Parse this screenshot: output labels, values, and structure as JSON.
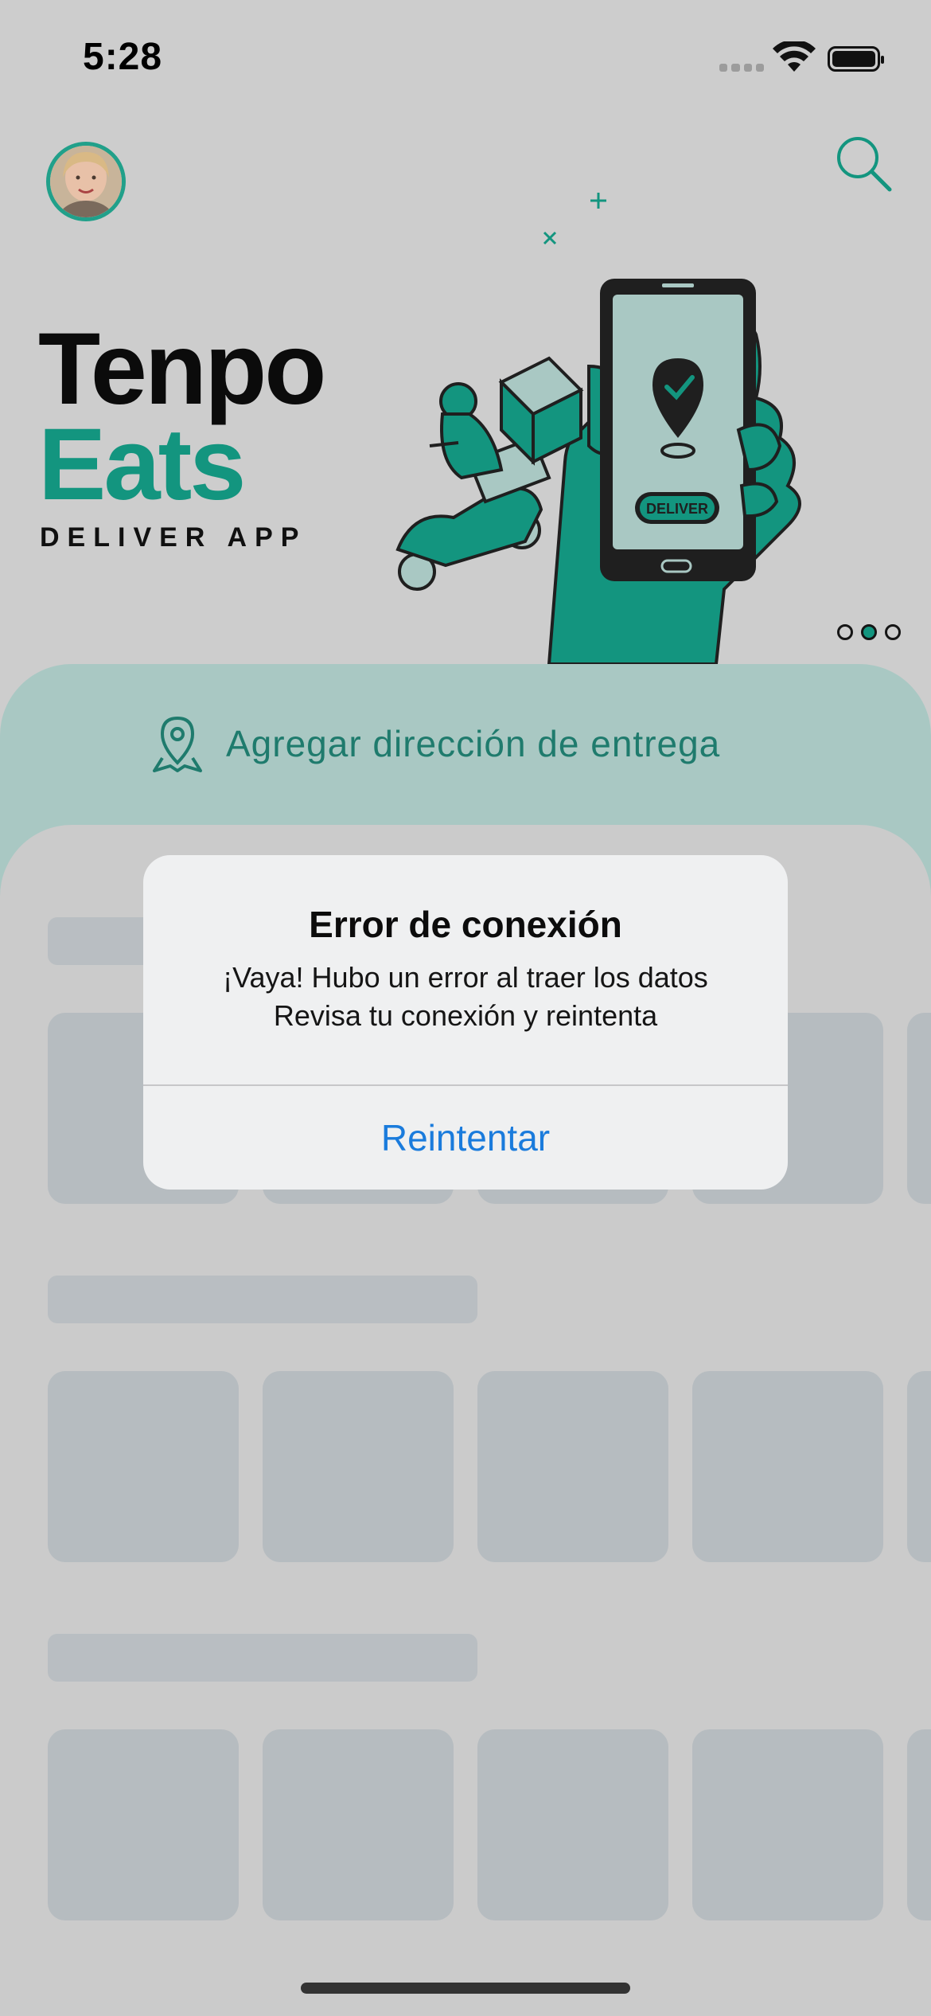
{
  "status_bar": {
    "time": "5:28"
  },
  "header": {
    "avatar_icon": "user-avatar",
    "search_icon": "search-icon"
  },
  "brand": {
    "line1": "Tenpo",
    "line2": "Eats",
    "subtitle": "DELIVER APP",
    "accent_color": "#13957f",
    "illustration_button_label": "DELIVER"
  },
  "carousel": {
    "page_count": 3,
    "active_index": 1
  },
  "address": {
    "icon": "location-pin-icon",
    "label": "Agregar dirección de entrega"
  },
  "alert": {
    "title": "Error de conexión",
    "message": "¡Vaya! Hubo un error al traer los datos\nRevisa tu conexión y reintenta",
    "button_label": "Reintentar",
    "button_color": "#1a7bdc"
  }
}
